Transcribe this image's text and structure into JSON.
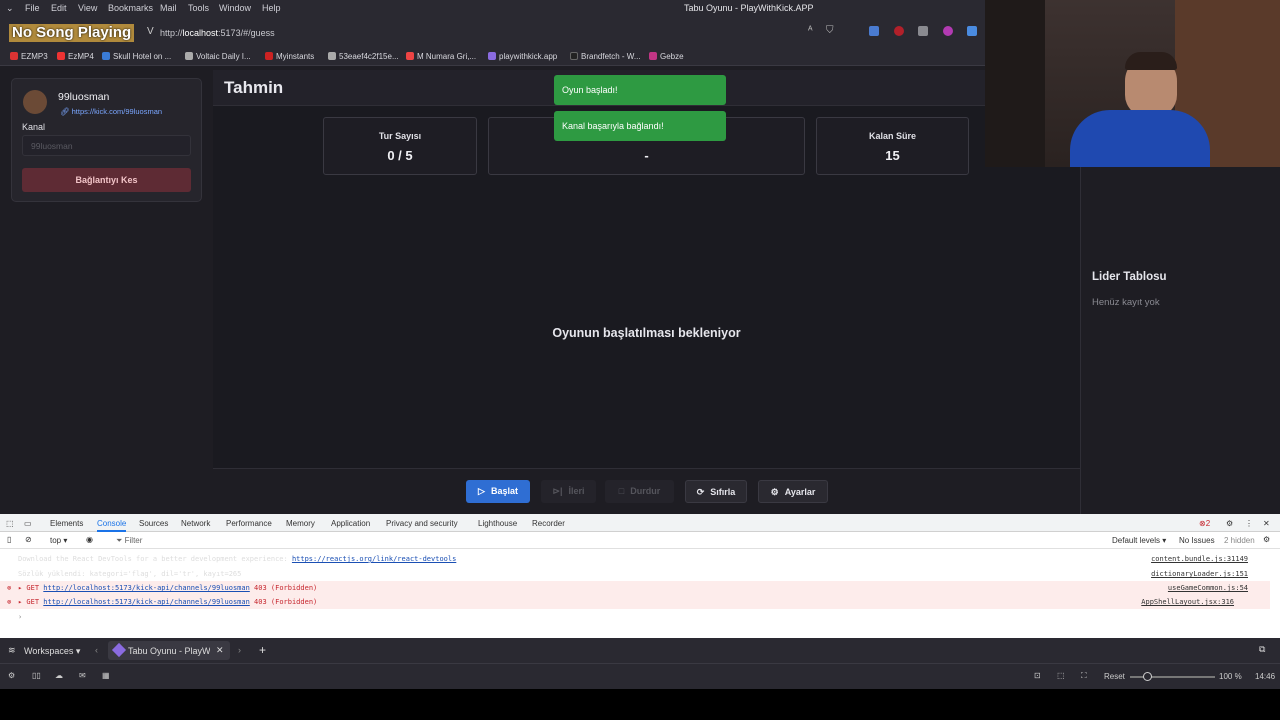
{
  "menubar": {
    "items": [
      "File",
      "Edit",
      "View",
      "Bookmarks",
      "Mail",
      "Tools",
      "Window",
      "Help"
    ],
    "window_title": "Tabu Oyunu - PlayWithKick.APP"
  },
  "overlay": {
    "no_song": "No Song Playing"
  },
  "address": {
    "url_prefix": "http://",
    "url_host": "localhost",
    "url_rest": ":5173/#/guess"
  },
  "bookmarks": [
    {
      "label": "EZMP3",
      "color": "#d33"
    },
    {
      "label": "EzMP4",
      "color": "#e33"
    },
    {
      "label": "Skull Hotel on ...",
      "color": "#3a7bd5"
    },
    {
      "label": "Voltaic Daily I...",
      "color": "#aaa"
    },
    {
      "label": "Myinstants",
      "color": "#c22"
    },
    {
      "label": "53eaef4c2f15e...",
      "color": "#aaa"
    },
    {
      "label": "M Numara Gri,...",
      "color": "#e44"
    },
    {
      "label": "playwithkick.app",
      "color": "#8a6be0"
    },
    {
      "label": "Brandfetch - W...",
      "color": "#222"
    },
    {
      "label": "Gebze",
      "color": "#c13584"
    }
  ],
  "sidebar": {
    "username": "99luosman",
    "link": "https://kick.com/99luosman",
    "channel_label": "Kanal",
    "channel_placeholder": "99luosman",
    "disconnect": "Bağlantıyı Kes"
  },
  "page": {
    "title": "Tahmin",
    "waiting": "Oyunun başlatılması bekleniyor"
  },
  "stats": [
    {
      "label": "Tur Sayısı",
      "value": "0 / 5"
    },
    {
      "label": "",
      "value": "-"
    },
    {
      "label": "Kalan Süre",
      "value": "15"
    }
  ],
  "toasts": [
    "Oyun başladı!",
    "Kanal başarıyla bağlandı!"
  ],
  "leaderboard": {
    "title": "Lider Tablosu",
    "empty": "Henüz kayıt yok"
  },
  "controls": {
    "start": "Başlat",
    "next": "İleri",
    "stop": "Durdur",
    "reset": "Sıfırla",
    "settings": "Ayarlar"
  },
  "devtools": {
    "tabs": [
      "Elements",
      "Console",
      "Sources",
      "Network",
      "Performance",
      "Memory",
      "Application",
      "Privacy and security",
      "Lighthouse",
      "Recorder"
    ],
    "active_tab": "Console",
    "error_count": "2",
    "context": "top",
    "filter_placeholder": "Filter",
    "levels": "Default levels",
    "issues": "No Issues",
    "hidden": "2 hidden",
    "lines": [
      {
        "text": "Download the React DevTools for a better development experience: ",
        "link": "https://reactjs.org/link/react-devtools",
        "source": "content.bundle.js:31149",
        "error": false
      },
      {
        "text": "Sözlük yüklendi: kategori='flag', dil='tr', kayıt=265",
        "link": "",
        "source": "dictionaryLoader.js:151",
        "error": false
      },
      {
        "text": "▸ GET ",
        "link": "http://localhost:5173/kick-api/channels/99luosman",
        "suffix": " 403 (Forbidden)",
        "source": "useGameCommon.js:54",
        "error": true
      },
      {
        "text": "▸ GET ",
        "link": "http://localhost:5173/kick-api/channels/99luosman",
        "suffix": " 403 (Forbidden)",
        "source": "AppShellLayout.jsx:316",
        "error": true
      }
    ],
    "prompt": "›"
  },
  "taskbar": {
    "workspaces": "Workspaces",
    "tab_title": "Tabu Oyunu - PlayWith"
  },
  "statusbar": {
    "reset": "Reset",
    "zoom": "100 %",
    "time": "14:46"
  }
}
